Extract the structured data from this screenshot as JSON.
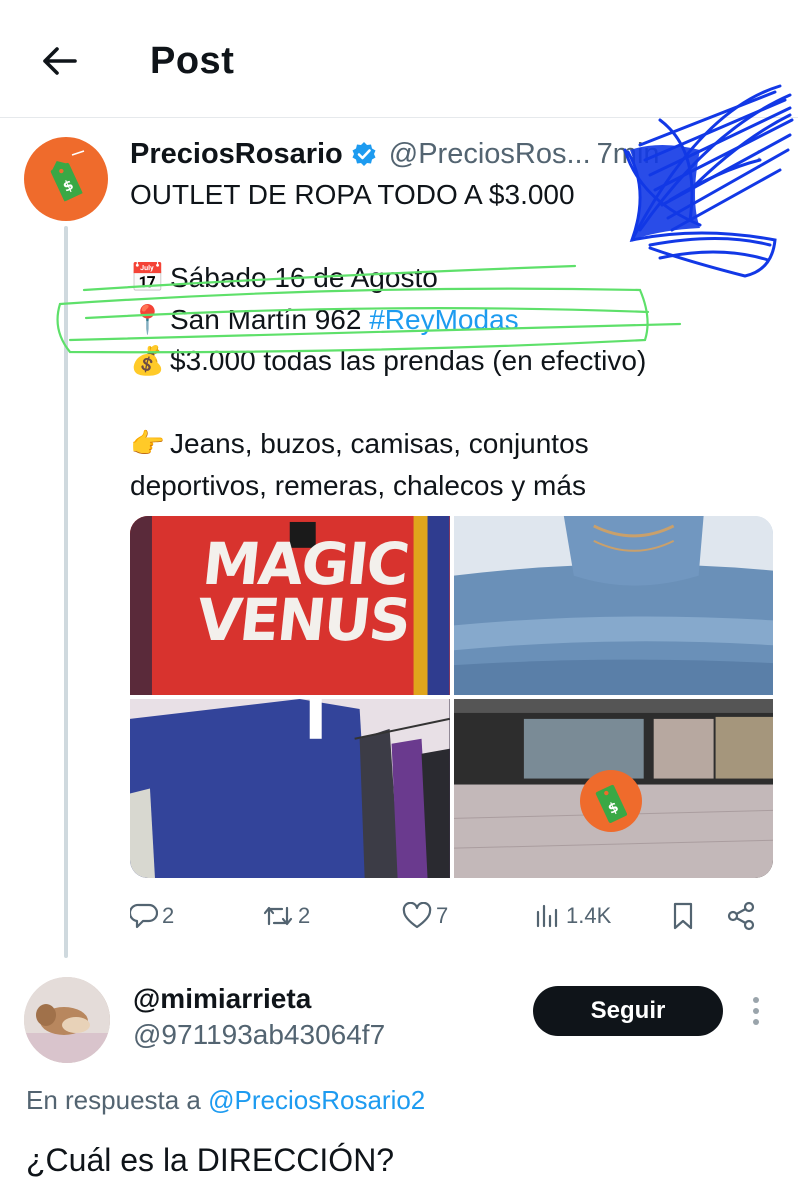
{
  "header": {
    "title": "Post",
    "back_icon": "arrow-left-icon"
  },
  "tweet": {
    "display_name": "PreciosRosario",
    "handle": "@PreciosRos...",
    "time": "7min",
    "verified": true,
    "text": {
      "line1": "OUTLET DE ROPA TODO A $3.000",
      "date": "Sábado 16 de Agosto",
      "address": "San Martín 962 ",
      "hashtag": "#ReyModas",
      "price": "$3.000 todas las prendas (en efectivo)",
      "items_line1": "Jeans, buzos, camisas, conjuntos",
      "items_line2": "deportivos, remeras, chalecos y más"
    },
    "emojis": {
      "calendar": "📅",
      "pin": "📍",
      "money_bag": "💰",
      "pointing": "👉"
    },
    "media": {
      "image1_text": "MAGIC VENUS"
    },
    "actions": {
      "replies": "2",
      "retweets": "2",
      "likes": "7",
      "views": "1.4K"
    }
  },
  "reply": {
    "display_name": "@mimiarrieta",
    "handle": "@971193ab43064f7",
    "follow_label": "Seguir",
    "in_reply_prefix": "En respuesta a ",
    "in_reply_mention": "@PreciosRosario2",
    "text": "¿Cuál es la DIRECCIÓN?"
  },
  "colors": {
    "accent": "#1d9bf0",
    "brand_orange": "#ef6b2c",
    "tag_green": "#3aa845",
    "highlight_green": "#5ee06a",
    "scribble_blue": "#1238e6",
    "secondary_text": "#536471"
  }
}
